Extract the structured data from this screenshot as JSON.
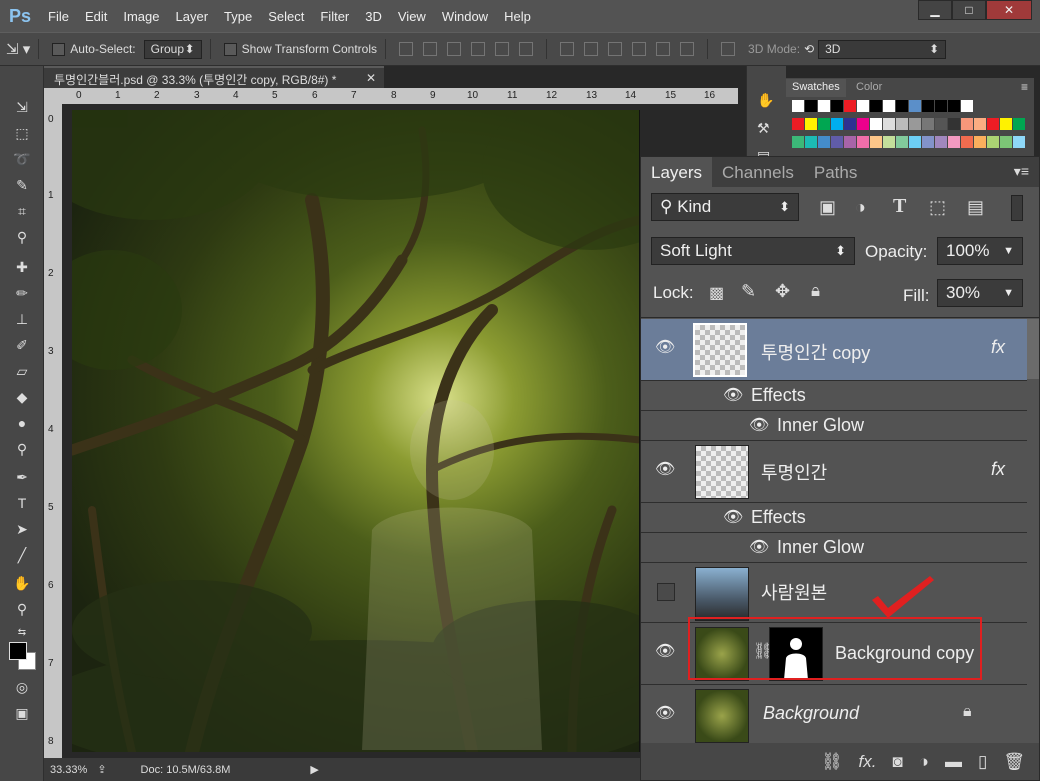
{
  "app": {
    "logo": "Ps",
    "menus": [
      "File",
      "Edit",
      "Image",
      "Layer",
      "Type",
      "Select",
      "Filter",
      "3D",
      "View",
      "Window",
      "Help"
    ]
  },
  "options": {
    "auto_select_label": "Auto-Select:",
    "auto_select_value": "Group",
    "transform_label": "Show Transform Controls",
    "mode_label": "3D Mode:",
    "mode_value": "3D"
  },
  "document": {
    "tab_title": "투명인간블러.psd @ 33.3% (투명인간 copy, RGB/8#) *",
    "zoom": "33.33%",
    "doc_size": "Doc: 10.5M/63.8M",
    "ruler_top": [
      "0",
      "1",
      "2",
      "3",
      "4",
      "5",
      "6",
      "7",
      "8",
      "9",
      "10",
      "11",
      "12",
      "13",
      "14",
      "15",
      "16"
    ],
    "ruler_left": [
      "0",
      "1",
      "2",
      "3",
      "4",
      "5",
      "6",
      "7",
      "8"
    ]
  },
  "swatches": {
    "tab_swatches": "Swatches",
    "tab_color": "Color"
  },
  "layers_panel": {
    "tabs": [
      "Layers",
      "Channels",
      "Paths"
    ],
    "filter_kind": "Kind",
    "blend_mode": "Soft Light",
    "opacity_label": "Opacity:",
    "opacity_value": "100%",
    "lock_label": "Lock:",
    "fill_label": "Fill:",
    "fill_value": "30%",
    "layers": [
      {
        "name": "투명인간 copy",
        "effects_label": "Effects",
        "effect": "Inner Glow"
      },
      {
        "name": "투명인간",
        "effects_label": "Effects",
        "effect": "Inner Glow"
      },
      {
        "name": "사람원본"
      },
      {
        "name": "Background copy"
      },
      {
        "name": "Background"
      }
    ]
  },
  "colors": {
    "annotation_red": "#e02020",
    "selected_layer": "#6b7d99"
  }
}
